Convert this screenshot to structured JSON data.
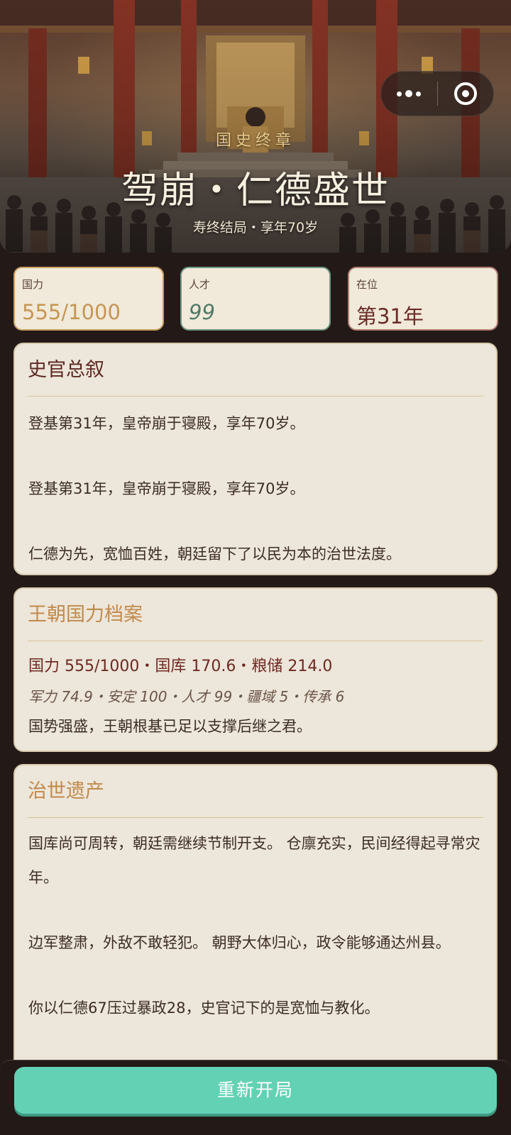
{
  "header": {
    "kicker": "国史终章",
    "title": "驾崩・仁德盛世",
    "subtitle": "寿终结局・享年70岁"
  },
  "stats": [
    {
      "label": "国力",
      "value": "555/1000"
    },
    {
      "label": "人才",
      "value": "99"
    },
    {
      "label": "在位",
      "value": "第31年"
    }
  ],
  "chronicle": {
    "title": "史官总叙",
    "paragraphs": [
      "登基第31年，皇帝崩于寝殿，享年70岁。",
      "登基第31年，皇帝崩于寝殿，享年70岁。",
      "仁德为先，宽恤百姓，朝廷留下了以民为本的治世法度。"
    ]
  },
  "archive": {
    "title": "王朝国力档案",
    "line1": "国力 555/1000・国库 170.6・粮储 214.0",
    "line2": "军力 74.9・安定 100・人才 99・疆域 5・传承 6",
    "line3": "国势强盛，王朝根基已足以支撑后继之君。"
  },
  "legacy": {
    "title": "治世遗产",
    "paragraphs": [
      "国库尚可周转，朝廷需继续节制开支。 仓廪充实，民间经得起寻常灾年。",
      "边军整肃，外敌不敢轻犯。 朝野大体归心，政令能够通达州县。",
      "你以仁德67压过暴政28，史官记下的是宽恤与教化。"
    ]
  },
  "actions": {
    "restart_label": "重新开局"
  },
  "icons": {
    "menu": "more-dots-icon",
    "close": "target-circle-icon"
  },
  "colors": {
    "background": "#231a18",
    "card": "#ede6da",
    "accent_gold": "#c08a4c",
    "accent_red": "#6e2922",
    "button": "#63d1b4"
  }
}
